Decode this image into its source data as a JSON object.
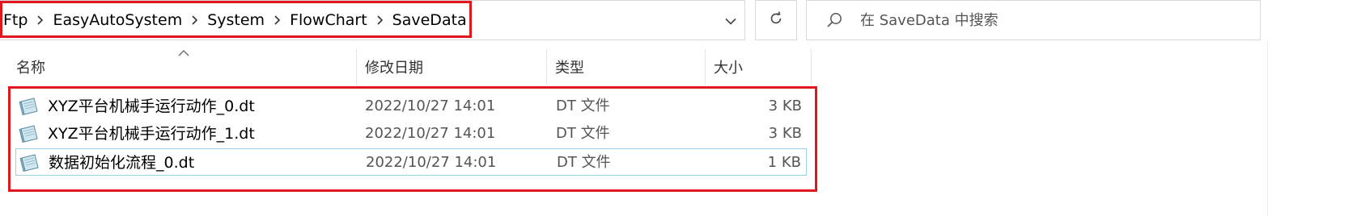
{
  "address_bar": {
    "breadcrumb": [
      "Ftp",
      "EasyAutoSystem",
      "System",
      "FlowChart",
      "SaveData"
    ]
  },
  "search": {
    "placeholder": "在 SaveData 中搜索"
  },
  "columns": {
    "name": "名称",
    "date_modified": "修改日期",
    "type": "类型",
    "size": "大小"
  },
  "files": [
    {
      "name": "XYZ平台机械手运行动作_0.dt",
      "date": "2022/10/27 14:01",
      "type": "DT 文件",
      "size": "3 KB"
    },
    {
      "name": "XYZ平台机械手运行动作_1.dt",
      "date": "2022/10/27 14:01",
      "type": "DT 文件",
      "size": "3 KB"
    },
    {
      "name": "数据初始化流程_0.dt",
      "date": "2022/10/27 14:01",
      "type": "DT 文件",
      "size": "1 KB"
    }
  ],
  "colors": {
    "highlight": "#e0181e",
    "focus_border": "#99d1e6"
  },
  "icons": {
    "breadcrumb_separator": "chevron-right-icon",
    "address_dropdown": "chevron-down-icon",
    "refresh": "refresh-icon",
    "search": "search-icon",
    "sort": "sort-up-icon",
    "file": "dt-file-icon"
  }
}
